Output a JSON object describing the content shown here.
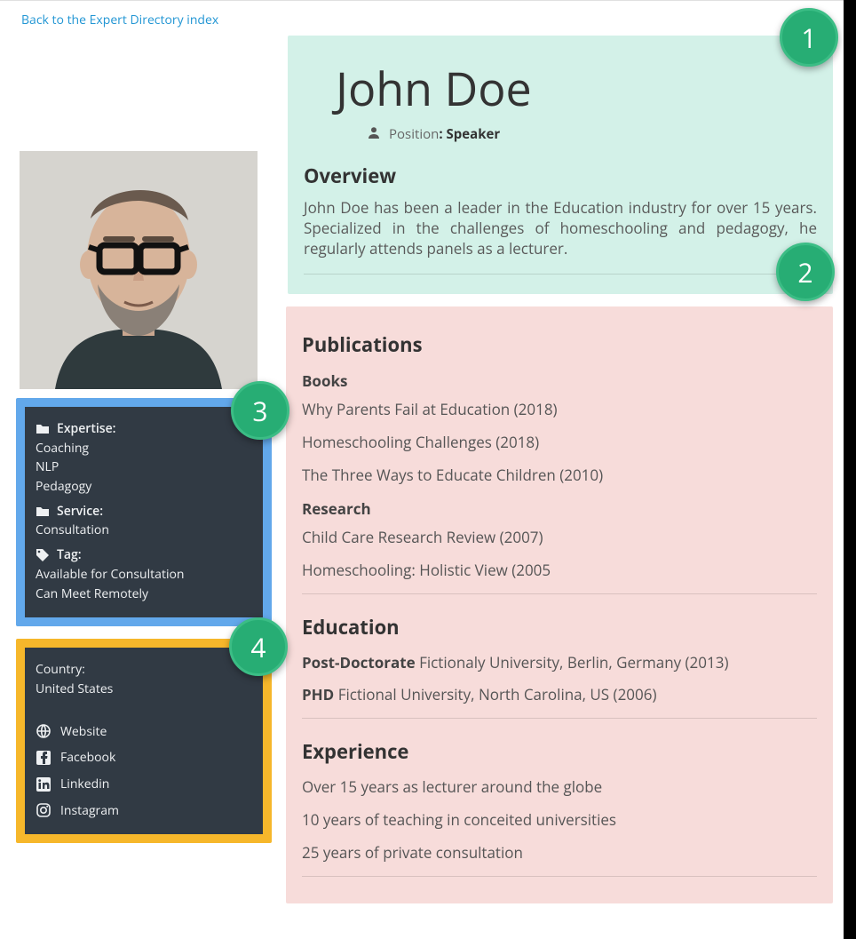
{
  "back_link": "Back to the Expert Directory index",
  "profile": {
    "name": "John Doe",
    "position_label": "Position",
    "position_value": ": Speaker",
    "overview_title": "Overview",
    "overview_text": "John Doe has been a leader in the Education industry for over 15 years. Specialized in the challenges of homeschooling and pedagogy, he regularly attends panels as a lecturer."
  },
  "publications": {
    "title": "Publications",
    "books_label": "Books",
    "books": [
      "Why Parents Fail at Education (2018)",
      "Homeschooling Challenges (2018)",
      "The Three Ways to Educate Children (2010)"
    ],
    "research_label": "Research",
    "research": [
      "Child Care Research Review (2007)",
      "Homeschooling: Holistic View (2005"
    ]
  },
  "education": {
    "title": "Education",
    "items": [
      {
        "degree": "Post-Doctorate",
        "rest": " Fictionaly University, Berlin, Germany (2013)"
      },
      {
        "degree": "PHD",
        "rest": " Fictional University, North Carolina, US (2006)"
      }
    ]
  },
  "experience": {
    "title": "Experience",
    "items": [
      "Over 15 years as lecturer around the globe",
      "10 years of teaching in conceited universities",
      "25 years of private consultation"
    ]
  },
  "sidebar": {
    "expertise_label": "Expertise:",
    "expertise": [
      "Coaching",
      "NLP",
      "Pedagogy"
    ],
    "service_label": "Service:",
    "service": [
      "Consultation"
    ],
    "tag_label": "Tag:",
    "tags": [
      "Available for Consultation",
      "Can Meet Remotely"
    ],
    "country_label": "Country:",
    "country_value": "United States",
    "links": [
      {
        "name": "Website"
      },
      {
        "name": "Facebook"
      },
      {
        "name": "Linkedin"
      },
      {
        "name": "Instagram"
      }
    ]
  },
  "badges": [
    "1",
    "2",
    "3",
    "4"
  ]
}
